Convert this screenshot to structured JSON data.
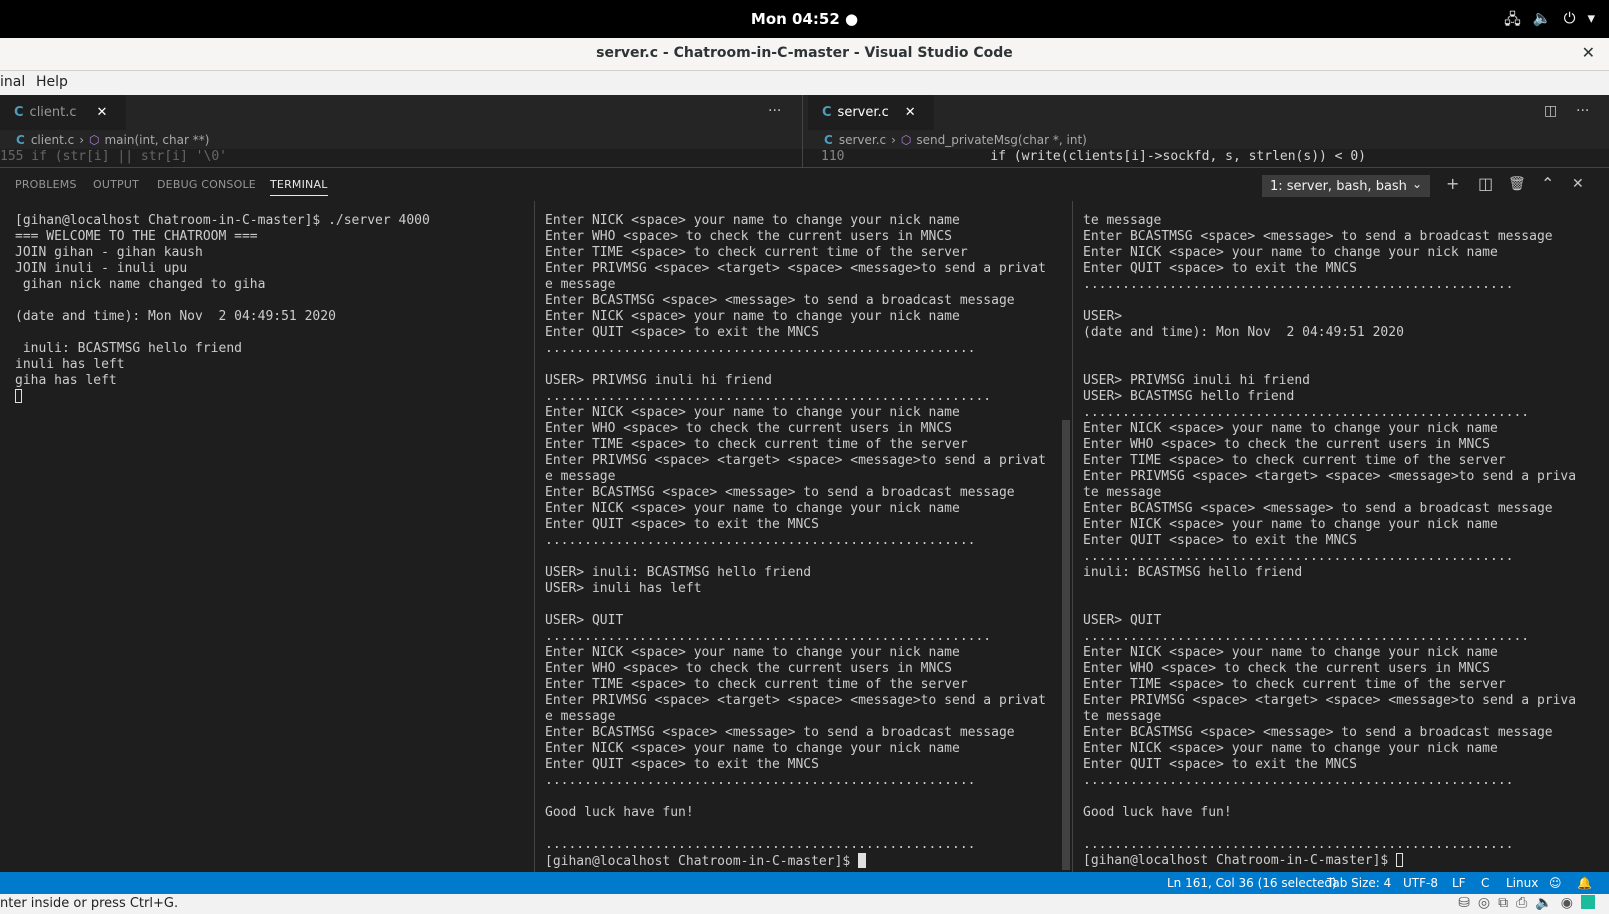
{
  "topbar": {
    "clock": "Mon 04:52 ●",
    "network_icon": "network-icon",
    "volume_icon": "volume-icon",
    "power_icon": "power-icon",
    "arrow": "▾"
  },
  "window": {
    "title": "server.c - Chatroom-in-C-master - Visual Studio Code",
    "close": "✕"
  },
  "menu": {
    "terminal": "inal",
    "help": "Help"
  },
  "editor": {
    "left": {
      "tab_label": "client.c",
      "close": "✕",
      "more": "···",
      "crumb_file": "client.c",
      "crumb_symbol": "main(int, char **)",
      "peek": "   155         if (str[i]     || str[i]    '\\0'"
    },
    "right": {
      "tab_label": "server.c",
      "close": "✕",
      "crumb_file": "server.c",
      "crumb_symbol": "send_privateMsg(char *, int)",
      "peek_line": "110",
      "peek_code": "if (write(clients[i]->sockfd, s, strlen(s)) < 0)"
    },
    "c_icon": "C",
    "sep": "›",
    "cube": "⬡"
  },
  "panel": {
    "tabs": [
      "PROBLEMS",
      "OUTPUT",
      "DEBUG CONSOLE",
      "TERMINAL"
    ],
    "terminal_select": "1: server, bash, bash",
    "chevron": "⌄",
    "icons": {
      "add": "+",
      "split": "◫",
      "trash": "🗑",
      "maximize": "⌃",
      "close": "✕"
    }
  },
  "terminals": {
    "left": "[gihan@localhost Chatroom-in-C-master]$ ./server 4000\n=== WELCOME TO THE CHATROOM ===\nJOIN gihan - gihan kaush\nJOIN inuli - inuli upu\n gihan nick name changed to giha\n\n(date and time): Mon Nov  2 04:49:51 2020\n\n inuli: BCASTMSG hello friend\ninuli has left\ngiha has left",
    "middle": "Enter NICK <space> your name to change your nick name\nEnter WHO <space> to check the current users in MNCS\nEnter TIME <space> to check current time of the server\nEnter PRIVMSG <space> <target> <space> <message>to send a privat\ne message\nEnter BCASTMSG <space> <message> to send a broadcast message\nEnter NICK <space> your name to change your nick name\nEnter QUIT <space> to exit the MNCS\n.......................................................\n\nUSER> PRIVMSG inuli hi friend\n.........................................................\nEnter NICK <space> your name to change your nick name\nEnter WHO <space> to check the current users in MNCS\nEnter TIME <space> to check current time of the server\nEnter PRIVMSG <space> <target> <space> <message>to send a privat\ne message\nEnter BCASTMSG <space> <message> to send a broadcast message\nEnter NICK <space> your name to change your nick name\nEnter QUIT <space> to exit the MNCS\n.......................................................\n\nUSER> inuli: BCASTMSG hello friend\nUSER> inuli has left\n\nUSER> QUIT\n.........................................................\nEnter NICK <space> your name to change your nick name\nEnter WHO <space> to check the current users in MNCS\nEnter TIME <space> to check current time of the server\nEnter PRIVMSG <space> <target> <space> <message>to send a privat\ne message\nEnter BCASTMSG <space> <message> to send a broadcast message\nEnter NICK <space> your name to change your nick name\nEnter QUIT <space> to exit the MNCS\n.......................................................\n\nGood luck have fun!\n\n.......................................................",
    "middle_prompt": "[gihan@localhost Chatroom-in-C-master]$ ",
    "right": "te message\nEnter BCASTMSG <space> <message> to send a broadcast message\nEnter NICK <space> your name to change your nick name\nEnter QUIT <space> to exit the MNCS\n.......................................................\n\nUSER>\n(date and time): Mon Nov  2 04:49:51 2020\n\n\nUSER> PRIVMSG inuli hi friend\nUSER> BCASTMSG hello friend\n.........................................................\nEnter NICK <space> your name to change your nick name\nEnter WHO <space> to check the current users in MNCS\nEnter TIME <space> to check current time of the server\nEnter PRIVMSG <space> <target> <space> <message>to send a priva\nte message\nEnter BCASTMSG <space> <message> to send a broadcast message\nEnter NICK <space> your name to change your nick name\nEnter QUIT <space> to exit the MNCS\n.......................................................\ninuli: BCASTMSG hello friend\n\n\nUSER> QUIT\n.........................................................\nEnter NICK <space> your name to change your nick name\nEnter WHO <space> to check the current users in MNCS\nEnter TIME <space> to check current time of the server\nEnter PRIVMSG <space> <target> <space> <message>to send a priva\nte message\nEnter BCASTMSG <space> <message> to send a broadcast message\nEnter NICK <space> your name to change your nick name\nEnter QUIT <space> to exit the MNCS\n.......................................................\n\nGood luck have fun!\n\n.......................................................",
    "right_prompt": "[gihan@localhost Chatroom-in-C-master]$ "
  },
  "status": {
    "position": "Ln 161, Col 36 (16 selected)",
    "tab_size": "Tab Size: 4",
    "encoding": "UTF-8",
    "eol": "LF",
    "language": "C",
    "os": "Linux",
    "feedback_icon": "☺",
    "bell_icon": "🔔"
  },
  "bottom": {
    "hint": "nter inside or press Ctrl+G."
  },
  "colors": {
    "statusbar": "#007acc",
    "panel_bg": "#1e1e1e",
    "accent_c": "#519aba"
  }
}
